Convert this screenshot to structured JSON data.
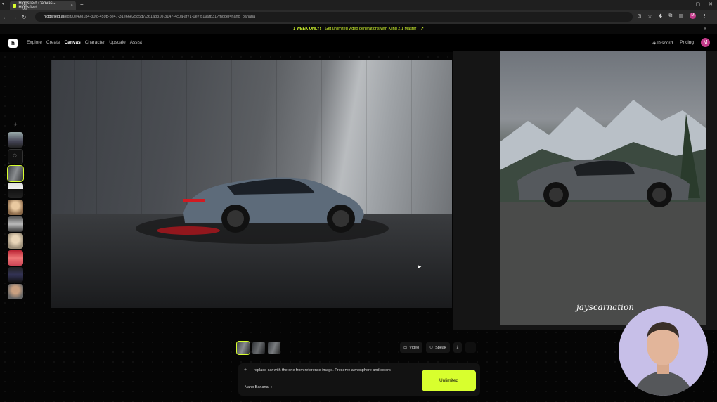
{
  "browser": {
    "tab_title": "Higgsfield Canvas - Higgsfield",
    "tab_close": "×",
    "new_tab": "+",
    "url_domain": "higgsfield.ai",
    "url_path": "/edit/0e4981b4-30fc-459b-be47-31e66e2585d7/361ab310-3147-4c0a-af71-0e7fb196fb31?model=nano_banana"
  },
  "promo": {
    "badge": "1 WEEK ONLY!",
    "text": "Get unlimited video generations with Kling 2.1 Master",
    "arrow": "↗",
    "close": "✕"
  },
  "nav": {
    "logo": "h",
    "links": [
      "Explore",
      "Create",
      "Canvas",
      "Character",
      "Upscale",
      "Assist"
    ],
    "active": "Canvas",
    "discord": "Discord",
    "pricing": "Pricing",
    "avatar": "M"
  },
  "rail": {
    "add": "+"
  },
  "reference": {
    "watermark": "jayscarnation"
  },
  "actions": {
    "video": "Video",
    "speak": "Speak"
  },
  "prompt": {
    "plus": "+",
    "text": "replace car with the one from reference image. Preserve atmosphere and colors",
    "model": "Nano Banana",
    "chevron": "›",
    "generate_label": "Unlimited"
  },
  "colors": {
    "accent": "#d8ff2e",
    "avatar": "#c33b8a"
  }
}
